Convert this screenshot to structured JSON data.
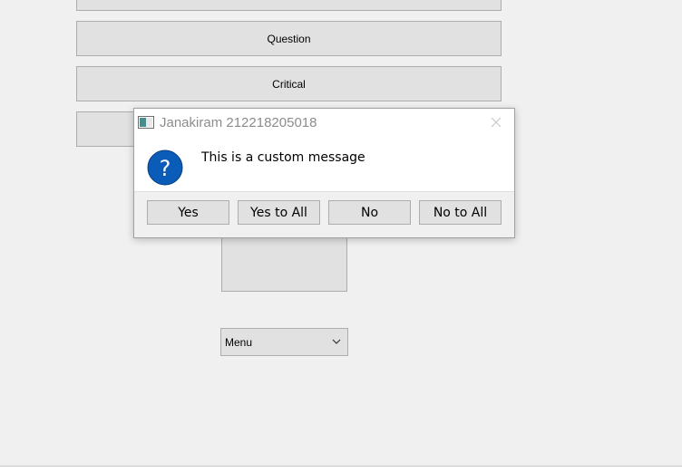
{
  "main": {
    "buttons": {
      "question": "Question",
      "critical": "Critical"
    },
    "menu": {
      "selected": "Menu",
      "chevron_icon": "chevron-down-icon"
    }
  },
  "dialog": {
    "title": "Janakiram 212218205018",
    "message": "This is a custom message",
    "icon": "question-icon",
    "icon_color": "#0a5cb8",
    "buttons": {
      "yes": "Yes",
      "yes_to_all": "Yes to All",
      "no": "No",
      "no_to_all": "No to All"
    }
  }
}
